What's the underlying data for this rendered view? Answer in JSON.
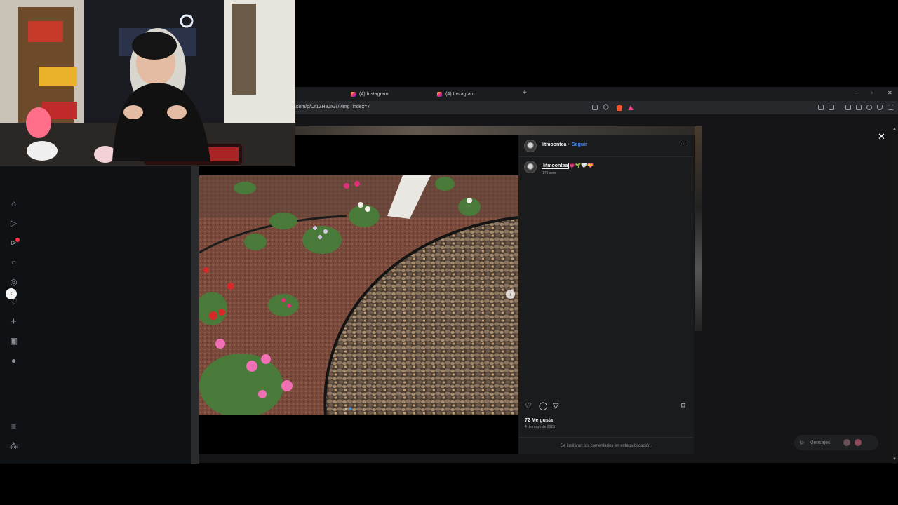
{
  "browser": {
    "tabs": [
      {
        "label": "(4) Instagram"
      },
      {
        "label": "(4) Instagram"
      }
    ],
    "new_tab_glyph": "+",
    "url": ".com/p/Cr1ZH8JIGil/?img_index=7",
    "window_controls": {
      "minimize": "–",
      "restore": "▫",
      "close": "✕"
    }
  },
  "sidebar": {
    "icons": [
      "home-icon",
      "reels-icon",
      "direct-icon",
      "search-icon",
      "explore-icon",
      "heart-icon",
      "create-icon",
      "dashboard-icon",
      "profile-icon",
      "menu-icon",
      "more-icon"
    ]
  },
  "post": {
    "username": "litmoontea",
    "separator": "•",
    "follow_label": "Seguir",
    "more_glyph": "···",
    "caption_user": "litmoontea",
    "caption_emoji": "💗🌱🤍💝",
    "caption_time": "149 sem",
    "likes": "72 Me gusta",
    "date": "4 de mayo de 2023",
    "comments_limited": "Se limitaron los comentarios en esta publicación.",
    "carousel": {
      "count": 2,
      "current": 2
    }
  },
  "overlay": {
    "close_glyph": "✕",
    "messages_label": "Mensajes",
    "prev_glyph": "‹",
    "next_glyph": "›"
  },
  "colors": {
    "accent_blue": "#4c8cf4",
    "notification_red": "#ff3040",
    "brave_orange": "#fb542b"
  }
}
